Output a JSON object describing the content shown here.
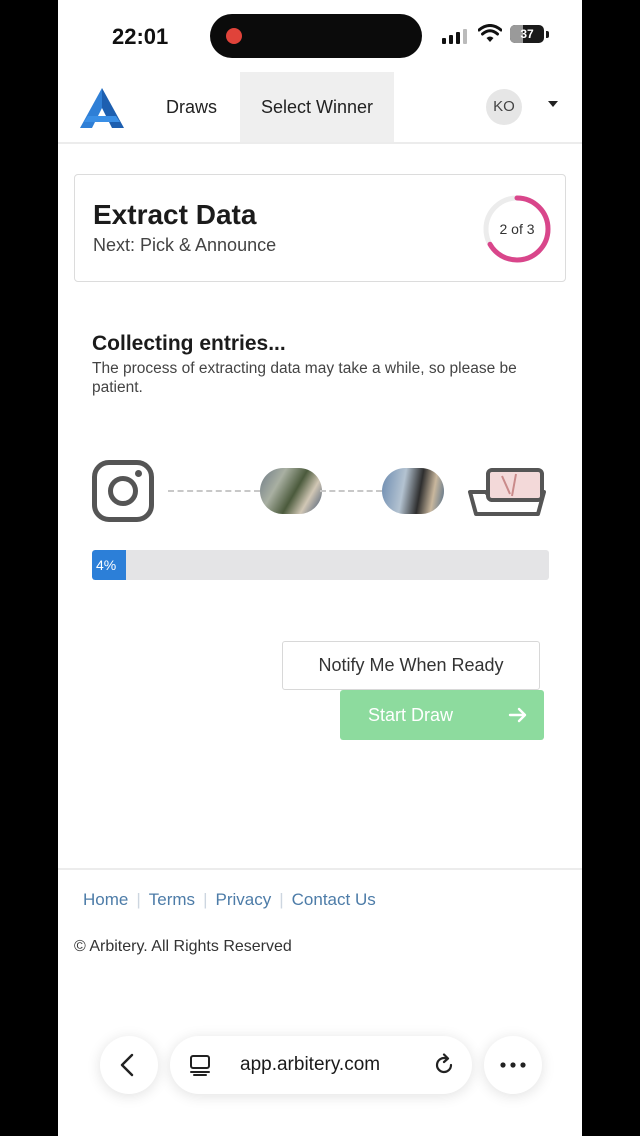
{
  "status_bar": {
    "time": "22:01",
    "battery_level": "37",
    "icons": [
      "recording-dot-icon",
      "signal-icon",
      "wifi-icon",
      "battery-icon"
    ]
  },
  "nav": {
    "logo_icon": "arbitery-logo",
    "items": [
      {
        "label": "Draws",
        "active": false
      },
      {
        "label": "Select Winner",
        "active": true
      }
    ],
    "avatar_initials": "KO",
    "dropdown_icon": "caret-down-icon"
  },
  "step": {
    "title": "Extract Data",
    "next": "Next: Pick & Announce",
    "progress_label": "2 of 3",
    "current": 2,
    "total": 3,
    "ring_color": "#d9468b"
  },
  "collecting": {
    "title": "Collecting entries...",
    "description": "The process of extracting data may take a while, so please be patient."
  },
  "flow": {
    "steps": [
      "instagram-icon",
      "photo-thumbnail",
      "photo-thumbnail",
      "tray-icon"
    ]
  },
  "progress": {
    "percent_label": "4%",
    "value": 0.04,
    "color": "#2c7fd8"
  },
  "actions": {
    "notify_label": "Notify Me When Ready",
    "start_label": "Start Draw",
    "start_color": "#8ddb9e",
    "start_enabled": false
  },
  "footer": {
    "links": [
      "Home",
      "Terms",
      "Privacy",
      "Contact Us"
    ],
    "copyright": "© Arbitery. All Rights Reserved"
  },
  "browser": {
    "url": "app.arbitery.com",
    "icons": [
      "back-icon",
      "tabs-icon",
      "reload-icon",
      "more-icon"
    ]
  }
}
